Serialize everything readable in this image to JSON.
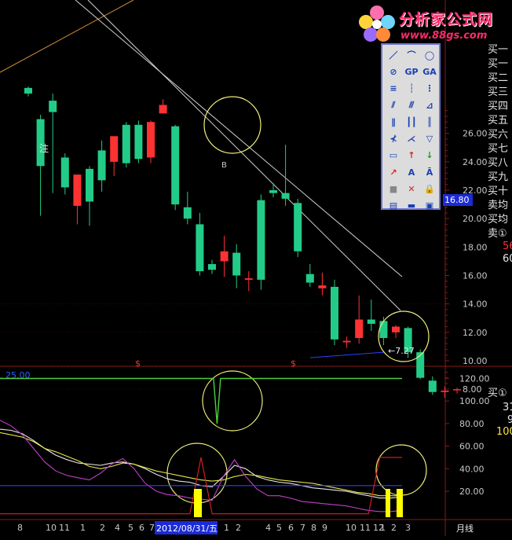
{
  "watermark": {
    "title": "分析家公式网",
    "url": "www.88gs.com"
  },
  "price_badge": "16.80",
  "last_price_label": "←7.27",
  "candle_marker": "注",
  "marker_b": "B",
  "sig_mark": "$",
  "ma_label": "25.00",
  "right_panel_top": {
    "items": [
      "买一",
      "买一",
      "买二",
      "买三",
      "买四",
      "买五",
      "买六",
      "买七",
      "买八",
      "买九",
      "买十",
      "卖均",
      "买均",
      "卖①"
    ],
    "v1": "56",
    "v2": "60"
  },
  "right_panel_bottom": {
    "items": [
      "买①"
    ],
    "v1": "31",
    "v2": "9",
    "v3": "100"
  },
  "date_label": "2012/08/31/五",
  "period_label": "月线",
  "toolbox": {
    "icons": [
      "line",
      "arc",
      "circle",
      "no",
      "GP",
      "GA",
      "fib-h",
      "fib-v",
      "fib-x",
      "channel-a",
      "channel-b",
      "channel-c",
      "parallel-a",
      "parallel-b",
      "parallel-c",
      "gann-a",
      "gann-b",
      "triangle",
      "rect",
      "arrow-up",
      "arrow-down",
      "arrow-line",
      "text-A",
      "text-A2",
      "block",
      "delete",
      "lock",
      "note",
      "ruler",
      "calc"
    ]
  },
  "chart_data": [
    {
      "type": "candlestick",
      "y_ticks": [
        8,
        10,
        12,
        14,
        16,
        18,
        20,
        22,
        24,
        26
      ],
      "y_tick_labels": [
        "8.00",
        "10.00",
        "12.00",
        "14.00",
        "16.00",
        "18.00",
        "20.00",
        "22.00",
        "24.00",
        "26.00"
      ],
      "ylim": [
        6.9,
        29.3
      ],
      "candles": [
        {
          "o": 29.2,
          "h": 29.3,
          "l": 28.6,
          "c": 28.8
        },
        {
          "o": 27.0,
          "h": 27.3,
          "l": 20.2,
          "c": 23.7
        },
        {
          "o": 28.3,
          "h": 28.8,
          "l": 21.8,
          "c": 27.5
        },
        {
          "o": 24.3,
          "h": 24.6,
          "l": 21.7,
          "c": 22.2
        },
        {
          "o": 20.9,
          "h": 23.0,
          "l": 19.6,
          "c": 23.1
        },
        {
          "o": 23.5,
          "h": 23.7,
          "l": 19.5,
          "c": 21.2
        },
        {
          "o": 24.8,
          "h": 25.5,
          "l": 21.9,
          "c": 22.7
        },
        {
          "o": 24.0,
          "h": 25.5,
          "l": 23.0,
          "c": 25.8
        },
        {
          "o": 26.6,
          "h": 26.8,
          "l": 23.6,
          "c": 23.9
        },
        {
          "o": 26.6,
          "h": 26.9,
          "l": 23.9,
          "c": 24.2
        },
        {
          "o": 24.3,
          "h": 26.9,
          "l": 23.9,
          "c": 26.8
        },
        {
          "o": 27.4,
          "h": 28.4,
          "l": 27.4,
          "c": 28.0
        },
        {
          "o": 26.5,
          "h": 26.6,
          "l": 20.6,
          "c": 21.0
        },
        {
          "o": 20.8,
          "h": 21.9,
          "l": 19.6,
          "c": 20.0
        },
        {
          "o": 19.6,
          "h": 20.4,
          "l": 16.0,
          "c": 16.3
        },
        {
          "o": 16.8,
          "h": 17.1,
          "l": 16.1,
          "c": 16.4
        },
        {
          "o": 17.0,
          "h": 18.8,
          "l": 15.9,
          "c": 17.7
        },
        {
          "o": 17.6,
          "h": 18.2,
          "l": 15.1,
          "c": 16.0
        },
        {
          "o": 15.7,
          "h": 16.3,
          "l": 14.9,
          "c": 15.8
        },
        {
          "o": 21.3,
          "h": 21.7,
          "l": 15.0,
          "c": 15.7
        },
        {
          "o": 22.0,
          "h": 22.5,
          "l": 21.5,
          "c": 21.8
        },
        {
          "o": 21.8,
          "h": 25.2,
          "l": 20.9,
          "c": 21.4
        },
        {
          "o": 21.1,
          "h": 21.4,
          "l": 17.3,
          "c": 17.7
        },
        {
          "o": 16.1,
          "h": 16.8,
          "l": 15.2,
          "c": 15.5
        },
        {
          "o": 15.1,
          "h": 16.2,
          "l": 14.6,
          "c": 15.3
        },
        {
          "o": 15.2,
          "h": 15.7,
          "l": 11.1,
          "c": 11.5
        },
        {
          "o": 11.3,
          "h": 11.7,
          "l": 10.9,
          "c": 11.4
        },
        {
          "o": 11.6,
          "h": 14.6,
          "l": 11.2,
          "c": 12.9
        },
        {
          "o": 12.9,
          "h": 14.3,
          "l": 12.1,
          "c": 12.6
        },
        {
          "o": 12.8,
          "h": 13.1,
          "l": 11.1,
          "c": 11.6
        },
        {
          "o": 12.0,
          "h": 12.5,
          "l": 11.6,
          "c": 12.4
        },
        {
          "o": 12.3,
          "h": 12.4,
          "l": 10.2,
          "c": 10.6
        },
        {
          "o": 10.6,
          "h": 10.8,
          "l": 8.7,
          "c": 8.8
        },
        {
          "o": 8.6,
          "h": 8.9,
          "l": 7.6,
          "c": 7.8
        },
        {
          "o": 7.8,
          "h": 8.2,
          "l": 7.4,
          "c": 7.9
        },
        {
          "o": 8.0,
          "h": 8.1,
          "l": 7.7,
          "c": 8.0
        }
      ]
    },
    {
      "type": "line",
      "y_ticks": [
        20,
        40,
        60,
        80,
        100,
        120
      ],
      "y_tick_labels": [
        "20.00",
        "40.00",
        "60.00",
        "80.00",
        "100.00",
        "120.00"
      ],
      "ylim": [
        -3,
        128
      ],
      "x_labels": [
        "8",
        "10",
        "11",
        "1",
        "2",
        "4",
        "5",
        "6",
        "7",
        "1",
        "2",
        "4",
        "5",
        "6",
        "7",
        "8",
        "9",
        "10",
        "11",
        "12",
        "1",
        "2",
        "3"
      ],
      "period": "月线",
      "series": [
        {
          "color": "#4dd13a",
          "values": [
            120,
            120,
            120,
            120,
            120,
            120,
            120,
            120,
            120,
            120,
            120,
            120,
            120,
            120,
            120,
            120,
            120,
            120,
            120,
            120,
            120,
            120,
            120,
            120,
            120,
            120,
            120,
            120,
            120,
            120,
            120,
            120,
            120,
            120,
            120,
            120,
            120,
            120,
            120,
            120,
            120,
            120,
            120,
            120,
            120,
            120,
            120,
            120,
            120,
            120,
            120,
            120,
            120,
            120,
            120,
            120,
            120,
            120,
            120,
            120,
            120,
            80,
            120,
            120,
            120,
            120,
            120,
            120,
            120,
            120,
            120,
            120,
            120,
            120,
            120,
            120,
            120,
            120,
            120,
            120,
            120,
            120,
            120,
            120,
            120,
            120,
            120,
            120,
            120,
            120,
            120,
            120,
            120,
            120,
            120,
            120,
            120,
            120,
            120,
            120,
            120,
            120,
            120,
            120,
            120,
            120,
            120,
            120,
            120,
            120,
            120,
            120,
            120,
            120
          ]
        },
        {
          "color": "#e8e8e8",
          "values": [
            75,
            74,
            71,
            65,
            58,
            52,
            48,
            45,
            44,
            43,
            45,
            46,
            44,
            40,
            35,
            31,
            29,
            28,
            25,
            24,
            33,
            43,
            40,
            33,
            30,
            28,
            27,
            25,
            23,
            22,
            21,
            20,
            18,
            16,
            14,
            14,
            15
          ]
        },
        {
          "color": "#e6e64a",
          "values": [
            72,
            70,
            68,
            64,
            58,
            55,
            51,
            47,
            42,
            40,
            42,
            45,
            44,
            41,
            38,
            36,
            34,
            32,
            30,
            29,
            30,
            33,
            35,
            34,
            32,
            30,
            29,
            28,
            27,
            25,
            23,
            21,
            19,
            18,
            16,
            16,
            16
          ]
        },
        {
          "color": "#c040c8",
          "values": [
            83,
            78,
            70,
            58,
            46,
            38,
            34,
            32,
            30,
            36,
            44,
            49,
            40,
            27,
            20,
            17,
            16,
            14,
            13,
            12,
            33,
            48,
            33,
            22,
            16,
            16,
            14,
            11,
            10,
            9,
            8,
            7,
            5,
            3,
            2,
            2,
            3
          ]
        },
        {
          "color": "#2d40ff",
          "values": [
            25,
            25,
            25,
            25,
            25,
            25,
            25,
            25,
            25,
            25,
            25,
            25,
            25,
            25,
            25,
            25,
            25,
            25,
            25,
            25,
            25,
            25,
            25,
            25,
            25,
            25,
            25,
            25,
            25,
            25,
            25,
            25,
            25,
            25,
            25,
            25,
            25
          ]
        },
        {
          "color": "#e02020",
          "values": [
            0,
            0,
            0,
            0,
            0,
            0,
            0,
            0,
            0,
            0,
            0,
            0,
            0,
            0,
            0,
            0,
            0,
            0,
            50,
            0,
            0,
            0,
            0,
            0,
            0,
            0,
            0,
            0,
            0,
            0,
            0,
            0,
            0,
            0,
            50,
            50,
            50
          ]
        }
      ]
    }
  ]
}
